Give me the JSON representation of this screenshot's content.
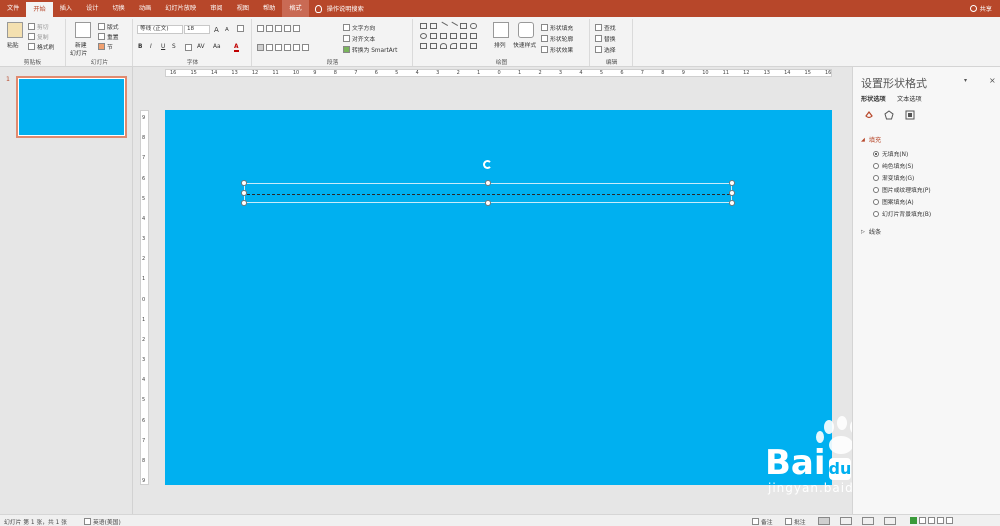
{
  "tabs": [
    "文件",
    "开始",
    "插入",
    "设计",
    "切换",
    "动画",
    "幻灯片放映",
    "审阅",
    "视图",
    "帮助",
    "格式"
  ],
  "active_tab": "开始",
  "tell_me": "操作说明搜索",
  "share": "共享",
  "ribbon": {
    "clipboard": {
      "label": "剪贴板",
      "paste": "粘贴",
      "cut": "剪切",
      "copy": "复制",
      "format_painter": "格式刷"
    },
    "slides": {
      "label": "幻灯片",
      "new_slide": "新建",
      "new_slide2": "幻灯片",
      "layout": "版式",
      "reset": "重置",
      "section": "节"
    },
    "font": {
      "label": "字体",
      "font_name": "等线 (正文)",
      "font_size": "18",
      "bold": "B",
      "italic": "I",
      "underline": "U",
      "strike": "S",
      "spacing": "AV",
      "case": "Aa",
      "color": "A",
      "grow": "A",
      "shrink": "A"
    },
    "paragraph": {
      "label": "段落",
      "text_direction": "文字方向",
      "align_text": "对齐文本",
      "smartart": "转换为 SmartArt"
    },
    "drawing": {
      "label": "绘图",
      "arrange": "排列",
      "quick_styles": "快速样式",
      "shape_fill": "形状填充",
      "shape_outline": "形状轮廓",
      "shape_effects": "形状效果"
    },
    "editing": {
      "label": "编辑",
      "find": "查找",
      "replace": "替换",
      "select": "选择"
    }
  },
  "thumbnail": {
    "number": "1"
  },
  "ruler_h": [
    "16",
    "15",
    "14",
    "13",
    "12",
    "11",
    "10",
    "9",
    "8",
    "7",
    "6",
    "5",
    "4",
    "3",
    "2",
    "1",
    "0",
    "1",
    "2",
    "3",
    "4",
    "5",
    "6",
    "7",
    "8",
    "9",
    "10",
    "11",
    "12",
    "13",
    "14",
    "15",
    "16"
  ],
  "ruler_v": [
    "9",
    "8",
    "7",
    "6",
    "5",
    "4",
    "3",
    "2",
    "1",
    "0",
    "1",
    "2",
    "3",
    "4",
    "5",
    "6",
    "7",
    "8",
    "9"
  ],
  "pane": {
    "title": "设置形状格式",
    "tab_shape": "形状选项",
    "tab_text": "文本选项",
    "fill_section": "填充",
    "fill_options": [
      "无填充(N)",
      "纯色填充(S)",
      "渐变填充(G)",
      "图片或纹理填充(P)",
      "图案填充(A)",
      "幻灯片背景填充(B)"
    ],
    "line_section": "线条"
  },
  "status": {
    "slide_info": "幻灯片 第 1 张，共 1 张",
    "language": "英语(美国)",
    "notes": "备注",
    "comments": "批注"
  },
  "watermark": {
    "brand": "Bai",
    "du": "du",
    "cn": "经验",
    "url": "jingyan.baidu.com"
  },
  "colors": {
    "accent": "#b7472a",
    "slide_bg": "#00b0f0"
  }
}
